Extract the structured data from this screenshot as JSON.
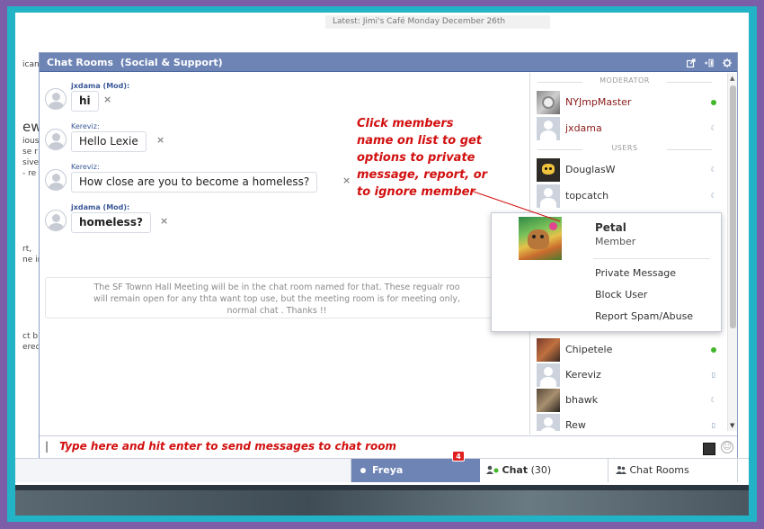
{
  "background_page": {
    "latest": "Latest: Jimi's Café Monday December 26th",
    "side_fragments": [
      "ican",
      "ew",
      "ious",
      "se r",
      "sive",
      "- re",
      "rt,",
      "ne in",
      "ct b",
      "ered"
    ]
  },
  "chat_window": {
    "title": "Chat Rooms",
    "room": "(Social & Support)",
    "messages": [
      {
        "author": "jxdama (Mod):",
        "text": "hi"
      },
      {
        "author": "Kereviz:",
        "text": "Hello Lexie"
      },
      {
        "author": "Kereviz:",
        "text": "How close are you to become a homeless?"
      },
      {
        "author": "jxdama (Mod):",
        "text": "homeless?"
      }
    ],
    "close_glyph": "×",
    "notice_lines": [
      "The SF Townn Hall Meeting will be in the chat room named for that. These regualr roo",
      "will remain open for any thta want top use, but the meeting room is for meeting only,",
      "normal chat . Thanks !!"
    ],
    "input_caret": "|",
    "input_hint": "Type here and hit enter to send messages to chat room",
    "smile_glyph": "☺"
  },
  "sidebar": {
    "moderator_header": "MODERATOR",
    "users_header": "USERS",
    "moderators": [
      {
        "name": "NYJmpMaster",
        "status": "online"
      },
      {
        "name": "jxdama",
        "status": "idle"
      }
    ],
    "users": [
      {
        "name": "DouglasW",
        "status": "idle"
      },
      {
        "name": "topcatch",
        "status": "idle"
      },
      {
        "name": "Chipetele",
        "status": "online"
      },
      {
        "name": "Kereviz",
        "status": "mobile"
      },
      {
        "name": "bhawk",
        "status": "idle"
      },
      {
        "name": "Rew",
        "status": "mobile"
      }
    ],
    "scroll_up": "▲",
    "scroll_down": "▼",
    "status_glyphs": {
      "idle": "☾",
      "mobile": "▯"
    }
  },
  "popover": {
    "name": "Petal",
    "role": "Member",
    "actions": [
      "Private Message",
      "Block User",
      "Report Spam/Abuse"
    ]
  },
  "annotation": {
    "lines": [
      "Click members",
      "name on list to get",
      "options to private",
      "message, report, or",
      "to ignore member"
    ]
  },
  "tabs": {
    "freya": "Freya",
    "freya_badge": "4",
    "chat_label": "Chat",
    "chat_count": "(30)",
    "rooms": "Chat Rooms"
  },
  "colors": {
    "header_blue": "#6d84b4",
    "annotation_red": "#d21010",
    "online_green": "#42b72a",
    "frame_teal": "#23b3c7",
    "frame_purple": "#7b5ea7"
  }
}
